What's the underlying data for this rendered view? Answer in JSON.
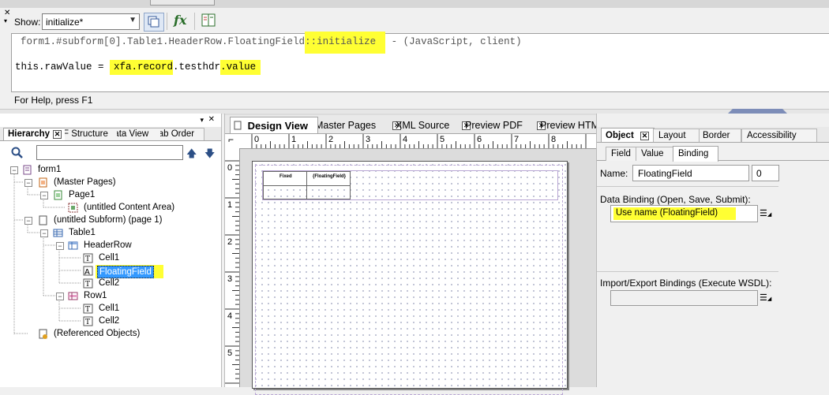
{
  "script_editor": {
    "show_label": "Show:",
    "event_value": "initialize*",
    "fn_label": "fx",
    "line1_prefix": "form1.#subform[0].Table1.HeaderRow.FloatingField",
    "line1_event": "::initialize",
    "line1_suffix": " - (JavaScript, client)",
    "line2_a": "this.rawValue = ",
    "line2_b": "xfa.record",
    "line2_c": ".testhdr",
    "line2_d": ".value",
    "status": "For Help, press F1"
  },
  "left_panel": {
    "tabs": [
      "Hierarchy",
      "PDF Structure",
      "Data View",
      "Tab Order"
    ],
    "tree": [
      {
        "label": "form1"
      },
      {
        "label": "(Master Pages)"
      },
      {
        "label": "Page1"
      },
      {
        "label": "(untitled Content Area)"
      },
      {
        "label": "(untitled Subform) (page 1)"
      },
      {
        "label": "Table1"
      },
      {
        "label": "HeaderRow"
      },
      {
        "label": "Cell1"
      },
      {
        "label": "FloatingField"
      },
      {
        "label": "Cell2"
      },
      {
        "label": "Row1"
      },
      {
        "label": "Cell1"
      },
      {
        "label": "Cell2"
      },
      {
        "label": "(Referenced Objects)"
      }
    ]
  },
  "center_panel": {
    "tabs": [
      "Design View",
      "Master Pages",
      "XML Source",
      "Preview PDF",
      "Preview HTML"
    ],
    "ruler_top": [
      "0",
      "1",
      "2",
      "3",
      "4",
      "5",
      "6",
      "7",
      "8"
    ],
    "ruler_left": [
      "0",
      "1",
      "2",
      "3",
      "4",
      "5"
    ],
    "table_headers": [
      "Fixed",
      "{FloatingField}"
    ]
  },
  "right_panel": {
    "tabs": [
      "Object",
      "Layout",
      "Border",
      "Accessibility"
    ],
    "subtabs": [
      "Field",
      "Value",
      "Binding"
    ],
    "name_label": "Name:",
    "name_value": "FloatingField",
    "name_index": "0",
    "data_binding_label": "Data Binding (Open, Save, Submit):",
    "data_binding_value": "Use name (FloatingField)",
    "import_export_label": "Import/Export Bindings (Execute WSDL):",
    "import_export_value": ""
  },
  "colors": {
    "highlight": "#ffff33",
    "selection": "#3399ff"
  }
}
